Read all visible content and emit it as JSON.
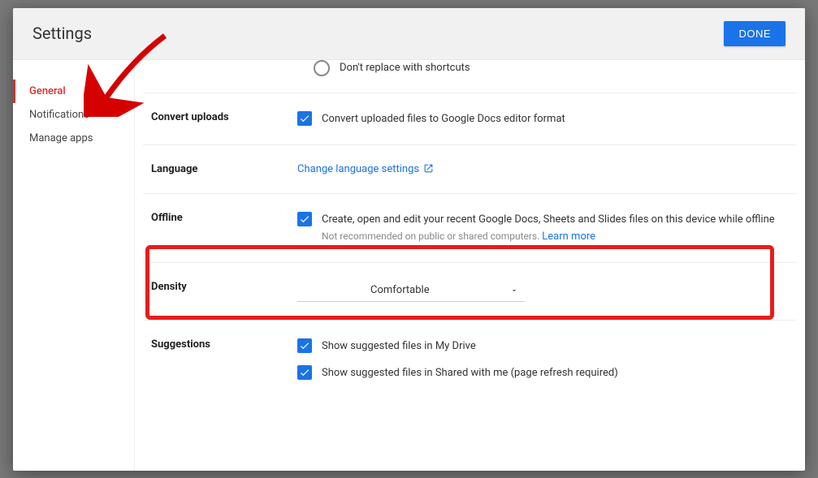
{
  "dialog": {
    "title": "Settings",
    "done_label": "DONE"
  },
  "sidebar": {
    "items": [
      {
        "label": "General",
        "active": true
      },
      {
        "label": "Notifications",
        "active": false
      },
      {
        "label": "Manage apps",
        "active": false
      }
    ]
  },
  "shortcut": {
    "radio_label": "Don't replace with shortcuts"
  },
  "convert": {
    "heading": "Convert uploads",
    "checkbox_label": "Convert uploaded files to Google Docs editor format"
  },
  "language": {
    "heading": "Language",
    "link_label": "Change language settings"
  },
  "offline": {
    "heading": "Offline",
    "checkbox_label": "Create, open and edit your recent Google Docs, Sheets and Slides files on this device while offline",
    "hint": "Not recommended on public or shared computers. ",
    "learn_more": "Learn more"
  },
  "density": {
    "heading": "Density",
    "value": "Comfortable"
  },
  "suggestions": {
    "heading": "Suggestions",
    "item1": "Show suggested files in My Drive",
    "item2": "Show suggested files in Shared with me (page refresh required)"
  }
}
